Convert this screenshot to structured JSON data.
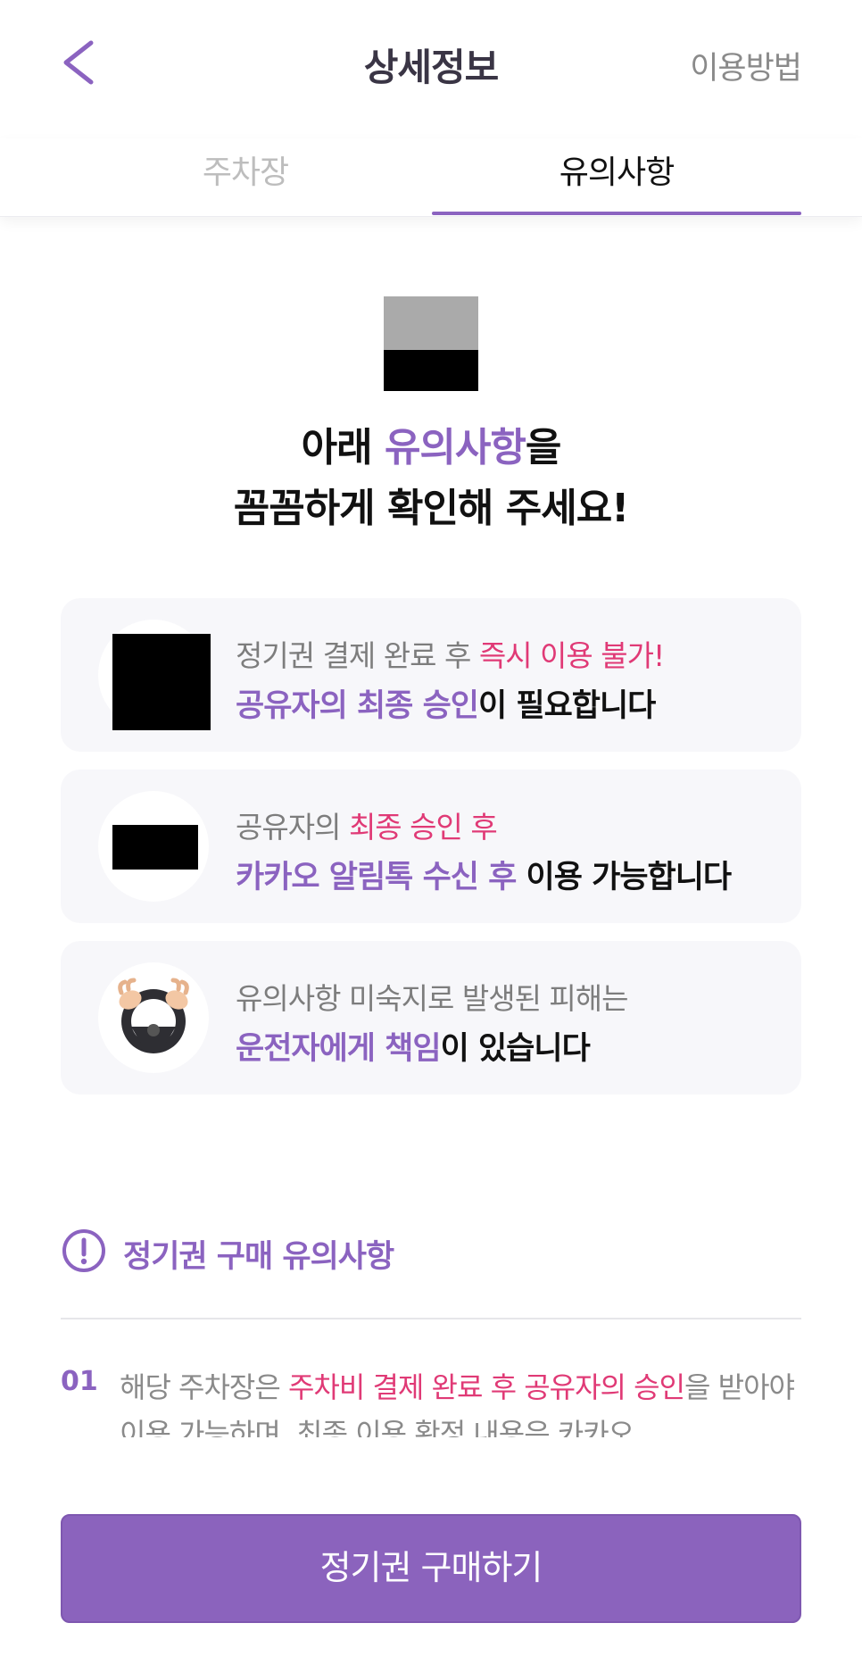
{
  "header": {
    "title": "상세정보",
    "help_label": "이용방법"
  },
  "tabs": [
    {
      "label": "주차장",
      "active": false
    },
    {
      "label": "유의사항",
      "active": true
    }
  ],
  "headline": {
    "line1_before": "아래 ",
    "line1_accent": "유의사항",
    "line1_after": "을",
    "line2": "꼼꼼하게 확인해 주세요!"
  },
  "cards": [
    {
      "icon": "redacted-image",
      "line1_plain": "정기권 결제 완료 후 ",
      "line1_highlight": "즉시 이용 불가!",
      "line2_accent": "공유자의 최종 승인",
      "line2_rest": "이 필요합니다"
    },
    {
      "icon": "redacted-image",
      "line1_plain": "공유자의 ",
      "line1_highlight": "최종 승인 후",
      "line2_accent": "카카오 알림톡 수신 후",
      "line2_rest": " 이용 가능합니다"
    },
    {
      "icon": "steering-wheel-icon",
      "line1_plain": "유의사항 미숙지로 발생된 피해는",
      "line1_highlight": "",
      "line2_accent": "운전자에게 책임",
      "line2_rest": "이 있습니다"
    }
  ],
  "notice": {
    "icon": "exclamation-circle-icon",
    "title": "정기권 구매 유의사항",
    "items": [
      {
        "number": "01",
        "text_before": "해당 주차장은 ",
        "text_highlight": "주차비 결제 완료 후 공유자의 승인",
        "text_after": "을 받아야 이용 가능하며, 최종 이용 확정 내용은 카카오"
      }
    ]
  },
  "cta": {
    "label": "정기권 구매하기"
  },
  "colors": {
    "accent": "#8b63c0",
    "highlight": "#e03a76",
    "card_bg": "#f7f7fa",
    "button_bg": "#8b63bd"
  }
}
